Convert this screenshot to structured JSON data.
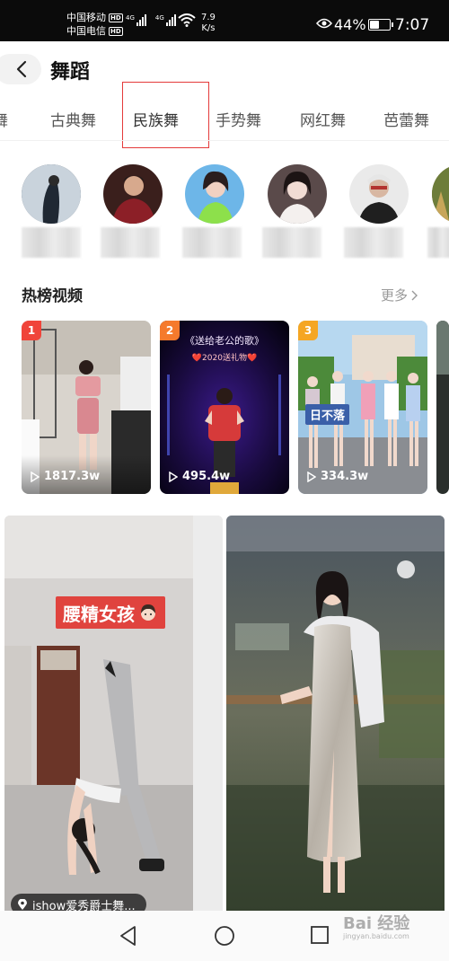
{
  "status_bar": {
    "carrier_1": "中国移动",
    "carrier_2": "中国电信",
    "hd_badge": "HD",
    "network": "4G",
    "speed_value": "7.9",
    "speed_unit": "K/s",
    "battery": "44%",
    "battery_level": 0.44,
    "time": "7:07"
  },
  "header": {
    "title": "舞蹈"
  },
  "tabs": [
    {
      "label": "舞"
    },
    {
      "label": "古典舞"
    },
    {
      "label": "民族舞",
      "active": true
    },
    {
      "label": "手势舞"
    },
    {
      "label": "网红舞"
    },
    {
      "label": "芭蕾舞"
    }
  ],
  "hot": {
    "title": "热榜视频",
    "more": "更多",
    "cards": [
      {
        "rank": "1",
        "plays": "1817.3w",
        "rank_color": "#f0443a"
      },
      {
        "rank": "2",
        "plays": "495.4w",
        "rank_color": "#f57a2c",
        "overlay_title": "《送给老公的歌》",
        "overlay_sub": "❤️2020送礼物❤️"
      },
      {
        "rank": "3",
        "plays": "334.3w",
        "rank_color": "#f5a623",
        "tag": "日不落"
      }
    ]
  },
  "feed": {
    "caption": "腰精女孩",
    "location": "ishow爱秀爵士舞..."
  },
  "watermark": {
    "brand": "Bai 经验",
    "sub": "jingyan.baidu.com"
  },
  "colors": {
    "accent": "#e43a3a",
    "status_bg": "#0b0b0b"
  },
  "icons": [
    "back-arrow-icon",
    "chevron-right-icon",
    "play-icon",
    "location-pin-icon",
    "nav-back-icon",
    "nav-home-icon",
    "nav-recents-icon",
    "wifi-icon",
    "eye-icon",
    "battery-icon"
  ]
}
